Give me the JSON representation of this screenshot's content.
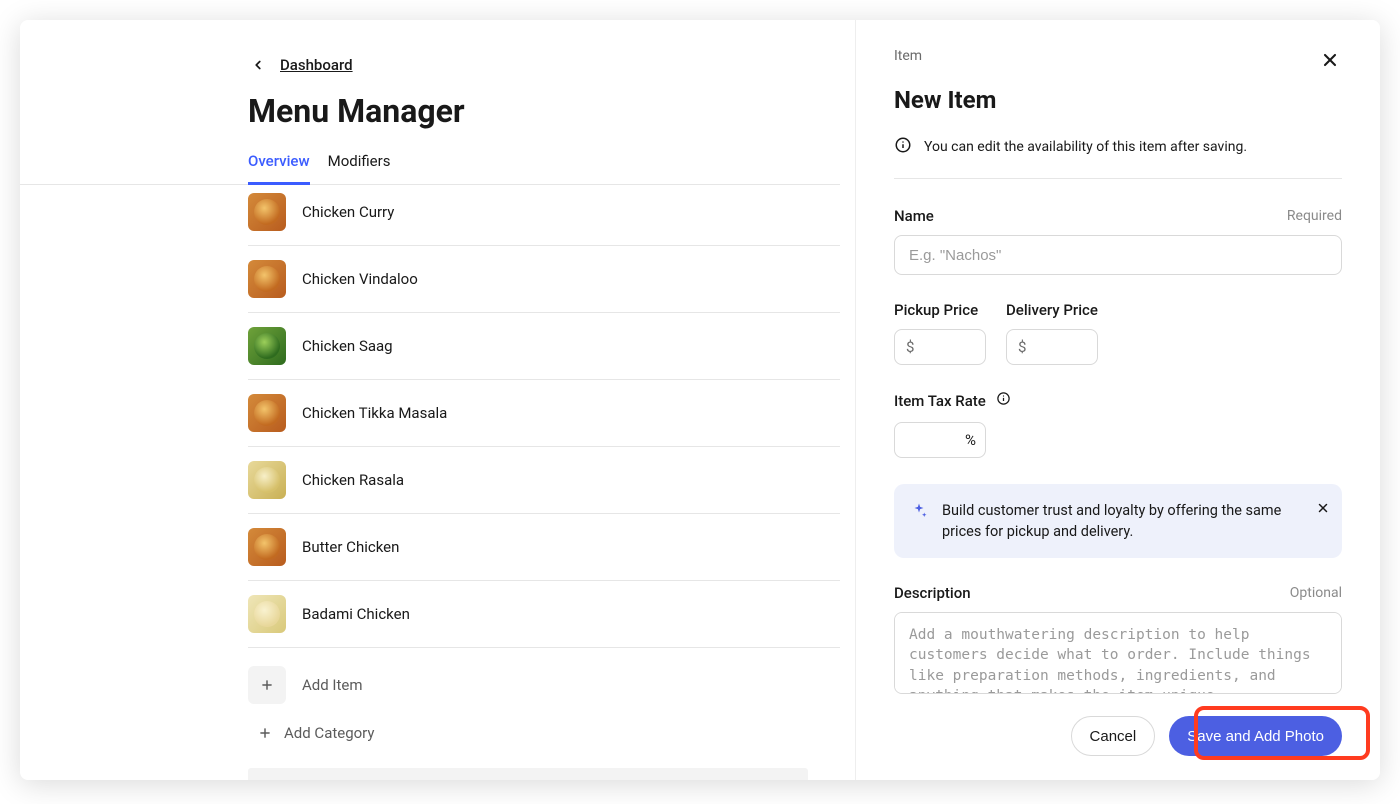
{
  "breadcrumb": {
    "back_label": "Dashboard"
  },
  "page": {
    "title": "Menu Manager"
  },
  "tabs": {
    "overview": "Overview",
    "modifiers": "Modifiers"
  },
  "items": [
    {
      "name": "Chicken Curry",
      "thumb": "curry"
    },
    {
      "name": "Chicken Vindaloo",
      "thumb": "curry"
    },
    {
      "name": "Chicken Saag",
      "thumb": "green"
    },
    {
      "name": "Chicken Tikka Masala",
      "thumb": "curry"
    },
    {
      "name": "Chicken Rasala",
      "thumb": "cream"
    },
    {
      "name": "Butter Chicken",
      "thumb": "curry"
    },
    {
      "name": "Badami Chicken",
      "thumb": "pale"
    }
  ],
  "add": {
    "item_label": "Add Item",
    "category_label": "Add Category"
  },
  "drawer": {
    "crumb": "Item",
    "title": "New Item",
    "info": "You can edit the availability of this item after saving.",
    "name_label": "Name",
    "name_required": "Required",
    "name_placeholder": "E.g. \"Nachos\"",
    "pickup_label": "Pickup Price",
    "delivery_label": "Delivery Price",
    "currency_symbol": "$",
    "tax_label": "Item Tax Rate",
    "percent_symbol": "%",
    "tip_text": "Build customer trust and loyalty by offering the same prices for pickup and delivery.",
    "desc_label": "Description",
    "desc_optional": "Optional",
    "desc_placeholder": "Add a mouthwatering description to help customers decide what to order. Include things like preparation methods, ingredients, and anything that makes the item unique.",
    "cancel": "Cancel",
    "save": "Save and Add Photo"
  }
}
